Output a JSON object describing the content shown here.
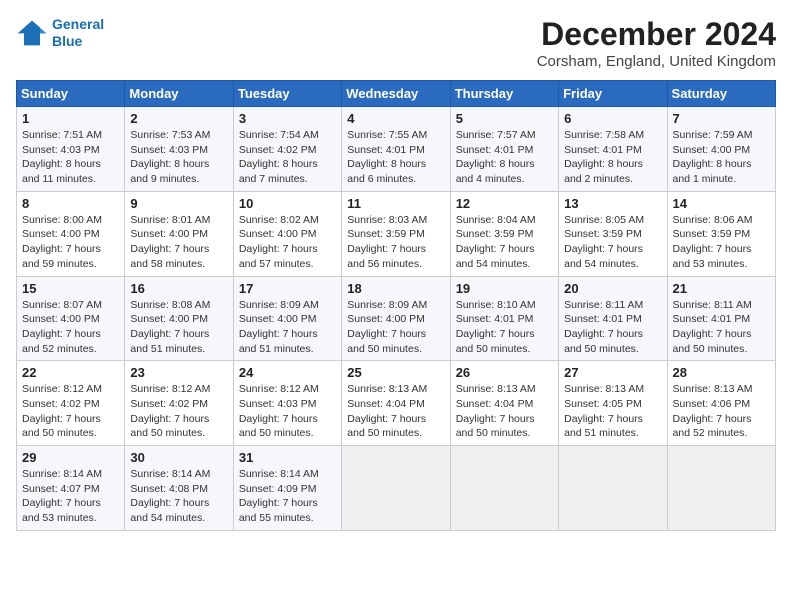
{
  "logo": {
    "line1": "General",
    "line2": "Blue"
  },
  "title": "December 2024",
  "subtitle": "Corsham, England, United Kingdom",
  "days_of_week": [
    "Sunday",
    "Monday",
    "Tuesday",
    "Wednesday",
    "Thursday",
    "Friday",
    "Saturday"
  ],
  "weeks": [
    [
      {
        "day": "1",
        "info": "Sunrise: 7:51 AM\nSunset: 4:03 PM\nDaylight: 8 hours\nand 11 minutes."
      },
      {
        "day": "2",
        "info": "Sunrise: 7:53 AM\nSunset: 4:03 PM\nDaylight: 8 hours\nand 9 minutes."
      },
      {
        "day": "3",
        "info": "Sunrise: 7:54 AM\nSunset: 4:02 PM\nDaylight: 8 hours\nand 7 minutes."
      },
      {
        "day": "4",
        "info": "Sunrise: 7:55 AM\nSunset: 4:01 PM\nDaylight: 8 hours\nand 6 minutes."
      },
      {
        "day": "5",
        "info": "Sunrise: 7:57 AM\nSunset: 4:01 PM\nDaylight: 8 hours\nand 4 minutes."
      },
      {
        "day": "6",
        "info": "Sunrise: 7:58 AM\nSunset: 4:01 PM\nDaylight: 8 hours\nand 2 minutes."
      },
      {
        "day": "7",
        "info": "Sunrise: 7:59 AM\nSunset: 4:00 PM\nDaylight: 8 hours\nand 1 minute."
      }
    ],
    [
      {
        "day": "8",
        "info": "Sunrise: 8:00 AM\nSunset: 4:00 PM\nDaylight: 7 hours\nand 59 minutes."
      },
      {
        "day": "9",
        "info": "Sunrise: 8:01 AM\nSunset: 4:00 PM\nDaylight: 7 hours\nand 58 minutes."
      },
      {
        "day": "10",
        "info": "Sunrise: 8:02 AM\nSunset: 4:00 PM\nDaylight: 7 hours\nand 57 minutes."
      },
      {
        "day": "11",
        "info": "Sunrise: 8:03 AM\nSunset: 3:59 PM\nDaylight: 7 hours\nand 56 minutes."
      },
      {
        "day": "12",
        "info": "Sunrise: 8:04 AM\nSunset: 3:59 PM\nDaylight: 7 hours\nand 54 minutes."
      },
      {
        "day": "13",
        "info": "Sunrise: 8:05 AM\nSunset: 3:59 PM\nDaylight: 7 hours\nand 54 minutes."
      },
      {
        "day": "14",
        "info": "Sunrise: 8:06 AM\nSunset: 3:59 PM\nDaylight: 7 hours\nand 53 minutes."
      }
    ],
    [
      {
        "day": "15",
        "info": "Sunrise: 8:07 AM\nSunset: 4:00 PM\nDaylight: 7 hours\nand 52 minutes."
      },
      {
        "day": "16",
        "info": "Sunrise: 8:08 AM\nSunset: 4:00 PM\nDaylight: 7 hours\nand 51 minutes."
      },
      {
        "day": "17",
        "info": "Sunrise: 8:09 AM\nSunset: 4:00 PM\nDaylight: 7 hours\nand 51 minutes."
      },
      {
        "day": "18",
        "info": "Sunrise: 8:09 AM\nSunset: 4:00 PM\nDaylight: 7 hours\nand 50 minutes."
      },
      {
        "day": "19",
        "info": "Sunrise: 8:10 AM\nSunset: 4:01 PM\nDaylight: 7 hours\nand 50 minutes."
      },
      {
        "day": "20",
        "info": "Sunrise: 8:11 AM\nSunset: 4:01 PM\nDaylight: 7 hours\nand 50 minutes."
      },
      {
        "day": "21",
        "info": "Sunrise: 8:11 AM\nSunset: 4:01 PM\nDaylight: 7 hours\nand 50 minutes."
      }
    ],
    [
      {
        "day": "22",
        "info": "Sunrise: 8:12 AM\nSunset: 4:02 PM\nDaylight: 7 hours\nand 50 minutes."
      },
      {
        "day": "23",
        "info": "Sunrise: 8:12 AM\nSunset: 4:02 PM\nDaylight: 7 hours\nand 50 minutes."
      },
      {
        "day": "24",
        "info": "Sunrise: 8:12 AM\nSunset: 4:03 PM\nDaylight: 7 hours\nand 50 minutes."
      },
      {
        "day": "25",
        "info": "Sunrise: 8:13 AM\nSunset: 4:04 PM\nDaylight: 7 hours\nand 50 minutes."
      },
      {
        "day": "26",
        "info": "Sunrise: 8:13 AM\nSunset: 4:04 PM\nDaylight: 7 hours\nand 50 minutes."
      },
      {
        "day": "27",
        "info": "Sunrise: 8:13 AM\nSunset: 4:05 PM\nDaylight: 7 hours\nand 51 minutes."
      },
      {
        "day": "28",
        "info": "Sunrise: 8:13 AM\nSunset: 4:06 PM\nDaylight: 7 hours\nand 52 minutes."
      }
    ],
    [
      {
        "day": "29",
        "info": "Sunrise: 8:14 AM\nSunset: 4:07 PM\nDaylight: 7 hours\nand 53 minutes."
      },
      {
        "day": "30",
        "info": "Sunrise: 8:14 AM\nSunset: 4:08 PM\nDaylight: 7 hours\nand 54 minutes."
      },
      {
        "day": "31",
        "info": "Sunrise: 8:14 AM\nSunset: 4:09 PM\nDaylight: 7 hours\nand 55 minutes."
      },
      {
        "day": "",
        "info": ""
      },
      {
        "day": "",
        "info": ""
      },
      {
        "day": "",
        "info": ""
      },
      {
        "day": "",
        "info": ""
      }
    ]
  ]
}
